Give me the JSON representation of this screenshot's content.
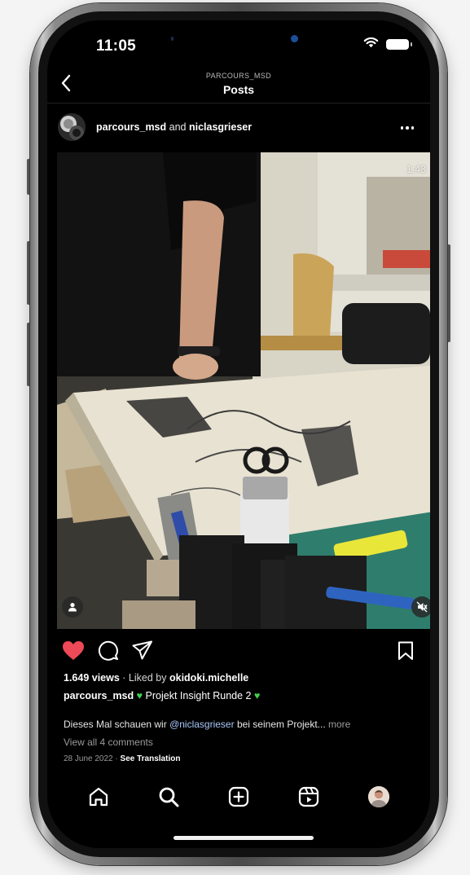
{
  "status_bar": {
    "time": "11:05"
  },
  "header": {
    "account": "PARCOURS_MSD",
    "title": "Posts"
  },
  "post": {
    "author_primary": "parcours_msd",
    "author_joiner": "and",
    "author_secondary": "niclasgrieser",
    "video_duration": "1:43",
    "views_count": "1.649 views",
    "liked_prefix": "· Liked by",
    "liked_by": "okidoki.michelle",
    "caption_user": "parcours_msd",
    "caption_text": "Projekt Insight Runde 2",
    "description_start": "Dieses Mal schauen wir",
    "description_mention": "@niclasgrieser",
    "description_end": "bei seinem Projekt...",
    "more_label": "more",
    "view_comments_label": "View all 4 comments",
    "date": "28 June 2022",
    "date_separator": "·",
    "see_translation_label": "See Translation"
  },
  "actions": {
    "liked": true,
    "like_color": "#ed4956"
  },
  "colors": {
    "background": "#000000",
    "caption_heart": "#3fd152",
    "mention": "#a8c7fa",
    "muted_text": "#9a9a9a"
  },
  "icons": {
    "header": [
      "back-icon"
    ],
    "post_actions": [
      "heart-icon",
      "comment-icon",
      "share-icon",
      "bookmark-icon"
    ],
    "video_overlay": [
      "tag-person-icon",
      "mute-icon"
    ],
    "bottom_nav": [
      "home-icon",
      "search-icon",
      "create-icon",
      "reels-icon",
      "profile-avatar"
    ]
  }
}
